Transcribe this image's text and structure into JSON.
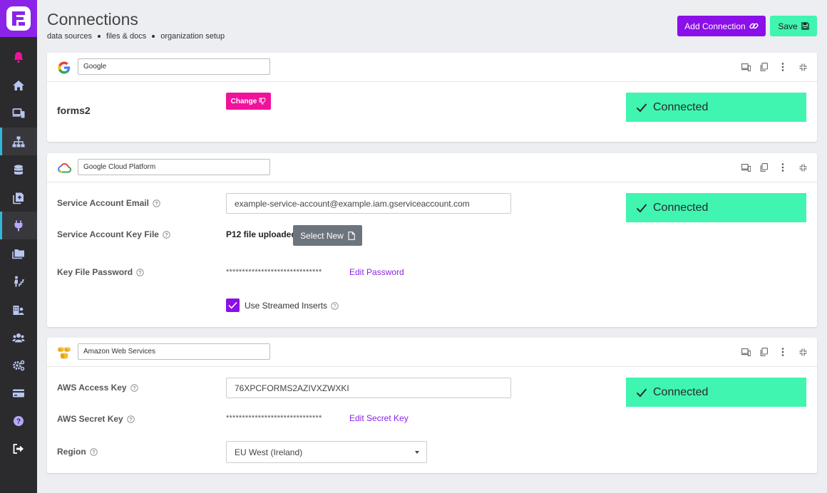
{
  "header": {
    "title": "Connections",
    "breadcrumb": [
      "data sources",
      "files & docs",
      "organization setup"
    ],
    "add_connection_label": "Add Connection",
    "save_label": "Save"
  },
  "sidebar": {
    "items": [
      {
        "icon": "bell-icon"
      },
      {
        "icon": "home-icon"
      },
      {
        "icon": "devices-icon"
      },
      {
        "icon": "sitemap-icon",
        "active": true
      },
      {
        "icon": "database-icon"
      },
      {
        "icon": "document-add-icon"
      },
      {
        "icon": "plug-icon",
        "active": true
      },
      {
        "icon": "folders-icon"
      },
      {
        "icon": "user-stairs-icon"
      },
      {
        "icon": "building-user-icon"
      },
      {
        "icon": "group-icon"
      },
      {
        "icon": "settings-icon"
      },
      {
        "icon": "credit-card-icon"
      },
      {
        "icon": "help-icon"
      },
      {
        "icon": "sign-out-icon"
      }
    ]
  },
  "google": {
    "name_value": "Google",
    "connection_name": "forms2",
    "change_label": "Change",
    "status": "Connected"
  },
  "gcp": {
    "name_value": "Google Cloud Platform",
    "email_label": "Service Account Email",
    "email_value": "example-service-account@example.iam.gserviceaccount.com",
    "key_file_label": "Service Account Key File",
    "key_file_status": "P12 file uploaded",
    "select_new_label": "Select New",
    "password_label": "Key File Password",
    "password_masked": "******************************",
    "edit_password_label": "Edit Password",
    "streamed_label": "Use Streamed Inserts",
    "streamed_checked": true,
    "status": "Connected"
  },
  "aws": {
    "name_value": "Amazon Web Services",
    "access_key_label": "AWS Access Key",
    "access_key_value": "76XPCFORMS2AZIVXZWXKI",
    "secret_key_label": "AWS Secret Key",
    "secret_masked": "******************************",
    "edit_secret_label": "Edit Secret Key",
    "region_label": "Region",
    "region_value": "EU West (Ireland)",
    "status": "Connected"
  },
  "colors": {
    "brand_purple": "#8b0fe8",
    "connected_green": "#40f5b0",
    "change_pink": "#f0129b",
    "sidebar_bg": "#2b2b2e"
  }
}
